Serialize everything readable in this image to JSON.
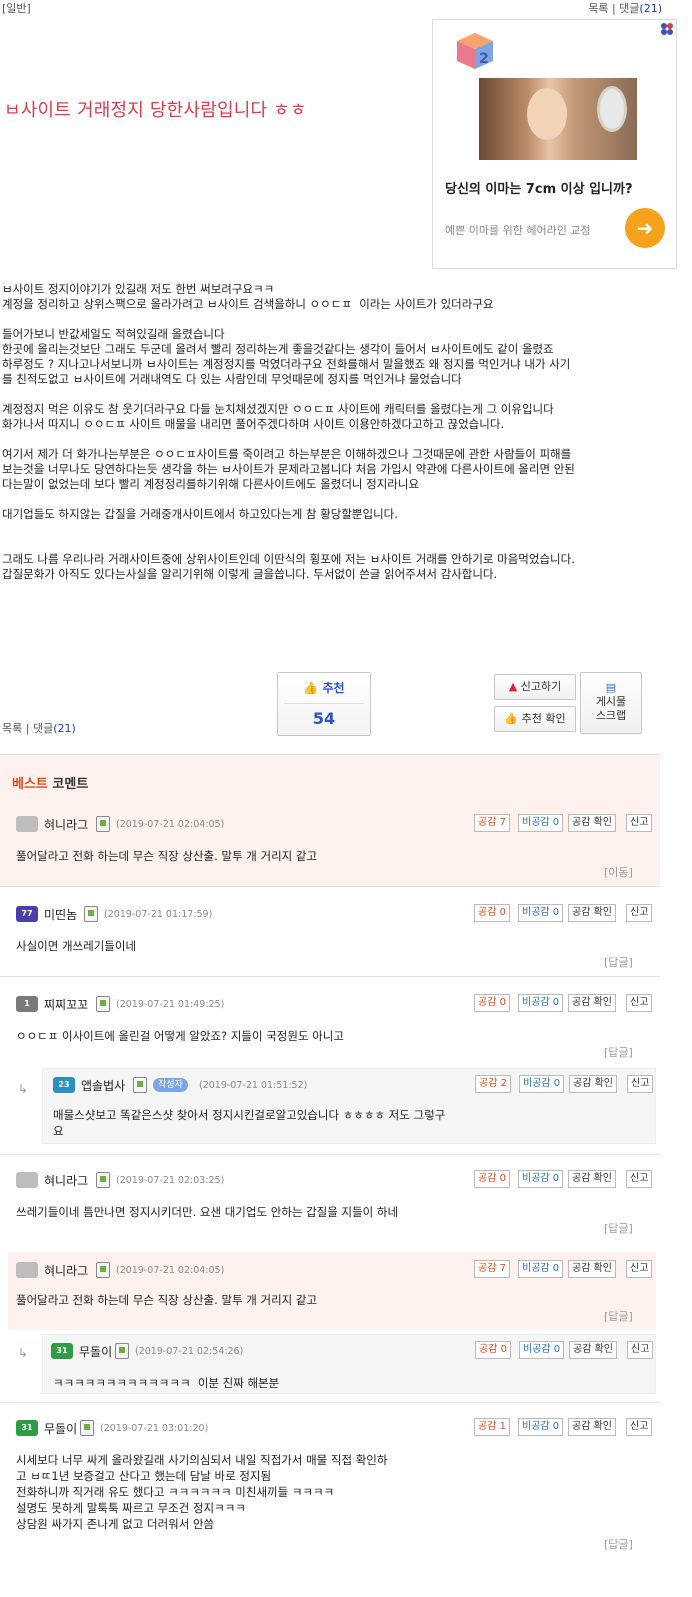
{
  "topbar": {
    "category": "[일반]",
    "list_label": "목록",
    "sep": "|",
    "comments_label": "댓글",
    "comments_count": "(21)"
  },
  "post": {
    "title": "ㅂ사이트 거래정지 당한사람입니다 ㅎㅎ",
    "body": "ㅂ사이트 정지이야기가 있길래 저도 한번 써보려구요ㅋㅋ\n계정을 정리하고 상위스팩으로 올라가려고 ㅂ사이트 검색을하니 ㅇㅇㄷㅍ  이라는 사이트가 있더라구요\n\n들어가보니 반값세일도 적혀있길래 올렸습니다\n한곳에 올리는것보단 그래도 두군데 올려서 빨리 정리하는게 좋을것같다는 생각이 들어서 ㅂ사이트에도 같이 올렸죠\n하루정도 ? 지나고나서보니까 ㅂ사이트는 계정정지를 먹였더라구요 전화를해서 말을했죠 왜 정지를 먹인거냐 내가 사기\n를 친적도없고 ㅂ사이트에 거래내역도 다 있는 사람인데 무엇때문에 정지를 먹인거냐 물었습니다\n\n계정정지 먹은 이유도 참 웃기더라구요 다들 눈치채셨겠지만 ㅇㅇㄷㅍ 사이트에 캐릭터를 올렸다는게 그 이유입니다\n화가나서 따지니 ㅇㅇㄷㅍ 사이트 매물을 내리면 풀어주겠다하며 사이트 이용안하겠다고하고 끊었습니다.\n\n여기서 제가 더 화가나는부분은 ㅇㅇㄷㅍ사이트를 죽이려고 하는부분은 이해하겠으나 그것때문에 관한 사람들이 피해를\n보는것을 너무나도 당연하다는듯 생각을 하는 ㅂ사이트가 문제라고봅니다 처음 가입시 약관에 다른사이트에 올리면 안된\n다는말이 없었는데 보다 빨리 계정정리를하기위해 다른사이트에도 올렸더니 정지라니요\n\n대기업들도 하지않는 갑질을 거래중개사이트에서 하고있다는게 참 황당할뿐입니다.\n\n\n그래도 나름 우리나라 거래사이트중에 상위사이트인데 이딴식의 횡포에 저는 ㅂ사이트 거래를 안하기로 마음먹었습니다.\n갑질문화가 아직도 있다는사실을 알리기위해 이렇게 글을씁니다. 두서없이 쓴글 읽어주셔서 감사합니다."
  },
  "ad": {
    "headline": "당신의 이마는 7cm 이상 입니까?",
    "subtext": "예쁜 이마를 위한 헤어라인 교정",
    "go_icon": "arrow-right-icon"
  },
  "actions": {
    "recommend_label": "추천",
    "recommend_count": "54",
    "report_label": "신고하기",
    "recommend_check_label": "추천 확인",
    "scrap_line1": "게시물",
    "scrap_line2": "스크랩"
  },
  "best_title_a": "베스트",
  "best_title_b": " 코멘트",
  "comment_common": {
    "agree": "공감",
    "disagree": "비공감",
    "check": "공감 확인",
    "report": "신고",
    "reply": "[답글]",
    "move": "[이동]"
  },
  "comments": [
    {
      "nick": "혀니라그",
      "level": "",
      "date": "(2019-07-21 02:04:05)",
      "agree": "7",
      "disagree": "0",
      "text": "풀어달라고 전화 하는데 무슨 직장 상산출. 말투 개 거리지 같고"
    },
    {
      "nick": "미띤놈",
      "level": "7",
      "date": "(2019-07-21 01:17:59)",
      "agree": "0",
      "disagree": "0",
      "text": "사실이면 개쓰레기들이네"
    },
    {
      "nick": "찌찌꼬꼬",
      "level": "1",
      "date": "(2019-07-21 01:49:25)",
      "agree": "0",
      "disagree": "0",
      "text": "ㅇㅇㄷㅍ 이사이트에 올린걸 어떻게 알았죠? 지들이 국정원도 아니고"
    },
    {
      "nick": "앱솔법사",
      "level": "23",
      "writer": "작성자",
      "date": "(2019-07-21 01:51:52)",
      "agree": "2",
      "disagree": "0",
      "text": "매물스샷보고 똑같은스샷 찾아서 정지시킨걸로알고있습니다 ㅎㅎㅎㅎ 저도 그렇구\n요"
    },
    {
      "nick": "혀니라그",
      "level": "",
      "date": "(2019-07-21 02:03:25)",
      "agree": "0",
      "disagree": "0",
      "text": "쓰레기들이네 틈만나면 정지시키더만. 요샌 대기업도 안하는 갑질을 지들이 하네"
    },
    {
      "nick": "혀니라그",
      "level": "",
      "date": "(2019-07-21 02:04:05)",
      "agree": "7",
      "disagree": "0",
      "text": "풀어달라고 전화 하는데 무슨 직장 상산출. 말투 개 거리지 같고"
    },
    {
      "nick": "무돌이",
      "level": "31",
      "date": "(2019-07-21 02:54:26)",
      "agree": "0",
      "disagree": "0",
      "text": "ㅋㅋㅋㅋㅋㅋㅋㅋㅋㅋㅋㅋㅋ  이분 진짜 해본분"
    },
    {
      "nick": "무돌이",
      "level": "31",
      "date": "(2019-07-21 03:01:20)",
      "agree": "1",
      "disagree": "0",
      "text": "시세보다 너무 싸게 올라왔길래 사기의심되서 내일 직접가서 매물 직접 확인하\n고 ㅂㄸ1년 보증걸고 산다고 했는데 담날 바로 정지됨\n전화하니까 직거래 유도 했다고 ㅋㅋㅋㅋㅋㅋ 미친새끼들 ㅋㅋㅋㅋ\n설명도 못하게 말툭툭 짜르고 무조건 정지ㅋㅋㅋ\n상담원 싸가지 존나게 없고 더러워서 안씀"
    }
  ]
}
